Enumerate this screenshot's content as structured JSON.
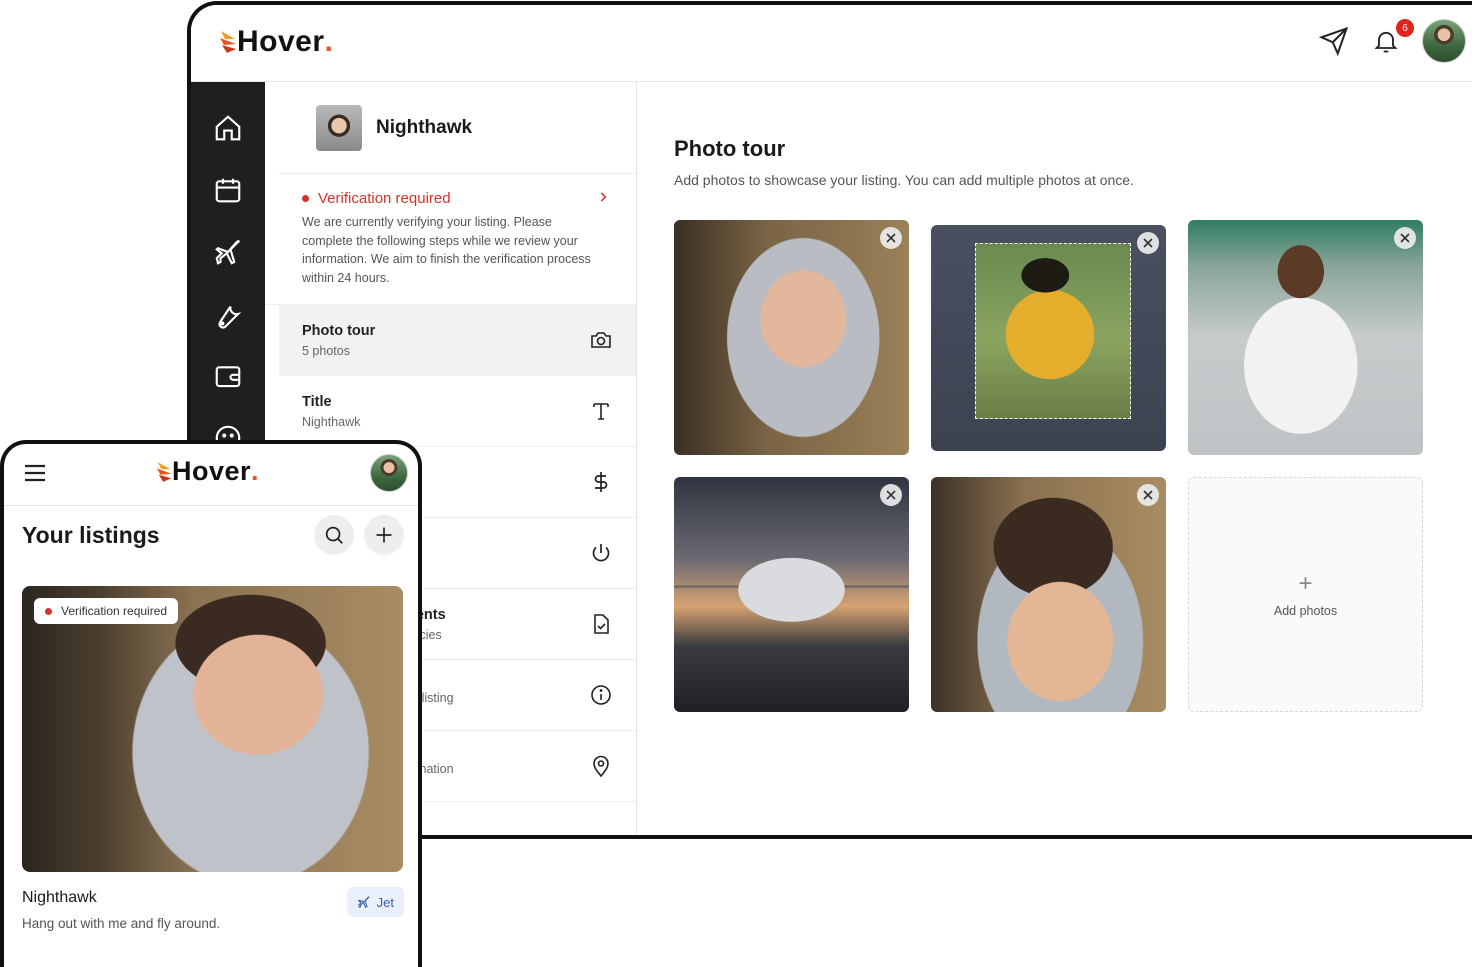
{
  "brand": {
    "name": "Hover",
    "dot": ".",
    "accent": "#e8541c"
  },
  "header": {
    "notification_count": "6"
  },
  "listing": {
    "name": "Nighthawk"
  },
  "verification": {
    "title": "Verification required",
    "text": "We are currently verifying your listing. Please complete the following steps while we review your information. We aim to finish the verification process within 24 hours."
  },
  "steps": [
    {
      "title": "Photo tour",
      "sub": "5 photos",
      "icon": "camera-icon"
    },
    {
      "title": "Title",
      "sub": "Nighthawk",
      "icon": "text-icon"
    },
    {
      "title": "",
      "sub": "",
      "icon": "dollar-icon"
    },
    {
      "title": "",
      "sub": "",
      "icon": "power-icon"
    },
    {
      "title": "nents",
      "sub": "olicies",
      "icon": "document-check-icon"
    },
    {
      "title": "",
      "sub": "ur listing",
      "icon": "info-icon"
    },
    {
      "title": "",
      "sub": "stination",
      "icon": "location-pin-icon"
    }
  ],
  "main": {
    "title": "Photo tour",
    "subtitle": "Add photos to showcase your listing. You can add multiple photos at once.",
    "add_photos_label": "Add photos",
    "add_plus": "+"
  },
  "mobile": {
    "title": "Your listings",
    "verify_chip": "Verification required",
    "card_name": "Nighthawk",
    "card_desc": "Hang out with me and fly around.",
    "tag": "Jet"
  }
}
